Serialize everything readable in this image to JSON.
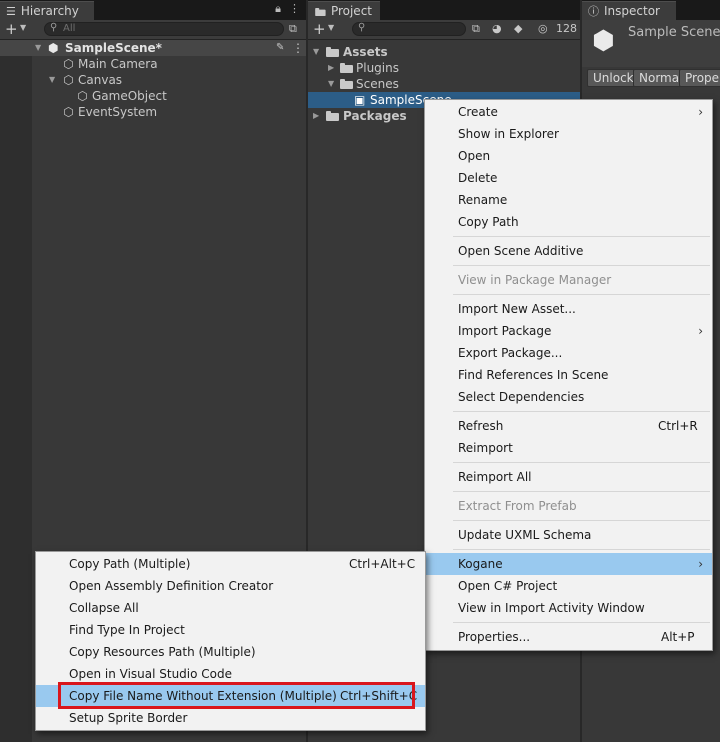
{
  "hierarchy": {
    "tab": "Hierarchy",
    "search_placeholder": "All",
    "scene": "SampleScene*",
    "items": [
      "Main Camera",
      "Canvas",
      "GameObject",
      "EventSystem"
    ]
  },
  "project": {
    "tab": "Project",
    "count": "128",
    "tree": [
      "Assets",
      "Plugins",
      "Scenes",
      "SampleScene",
      "Packages"
    ]
  },
  "inspector": {
    "tab": "Inspector",
    "title": "Sample Scene",
    "buttons": [
      "Unlock",
      "Normal",
      "Proper"
    ]
  },
  "context_menu": {
    "items": [
      {
        "label": "Create",
        "submenu": true
      },
      {
        "label": "Show in Explorer"
      },
      {
        "label": "Open"
      },
      {
        "label": "Delete"
      },
      {
        "label": "Rename"
      },
      {
        "label": "Copy Path"
      },
      {
        "label": "Open Scene Additive"
      },
      {
        "label": "View in Package Manager",
        "disabled": true
      },
      {
        "label": "Import New Asset..."
      },
      {
        "label": "Import Package",
        "submenu": true
      },
      {
        "label": "Export Package..."
      },
      {
        "label": "Find References In Scene"
      },
      {
        "label": "Select Dependencies"
      },
      {
        "label": "Refresh",
        "shortcut": "Ctrl+R"
      },
      {
        "label": "Reimport"
      },
      {
        "label": "Reimport All"
      },
      {
        "label": "Extract From Prefab",
        "disabled": true
      },
      {
        "label": "Update UXML Schema"
      },
      {
        "label": "Kogane",
        "submenu": true,
        "highlighted": true
      },
      {
        "label": "Open C# Project"
      },
      {
        "label": "View in Import Activity Window"
      },
      {
        "label": "Properties...",
        "shortcut": "Alt+P"
      }
    ]
  },
  "submenu": {
    "items": [
      {
        "label": "Copy Path (Multiple)",
        "shortcut": "Ctrl+Alt+C"
      },
      {
        "label": "Open Assembly Definition Creator"
      },
      {
        "label": "Collapse All"
      },
      {
        "label": "Find Type In Project"
      },
      {
        "label": "Copy Resources Path (Multiple)"
      },
      {
        "label": "Open in Visual Studio Code"
      },
      {
        "label": "Copy File Name Without Extension (Multiple)",
        "shortcut": "Ctrl+Shift+C",
        "highlighted": true
      },
      {
        "label": "Setup Sprite Border"
      }
    ]
  },
  "colors": {
    "highlight": "#99c9ef",
    "selection": "#2c5d87",
    "callout": "#d9161c"
  }
}
